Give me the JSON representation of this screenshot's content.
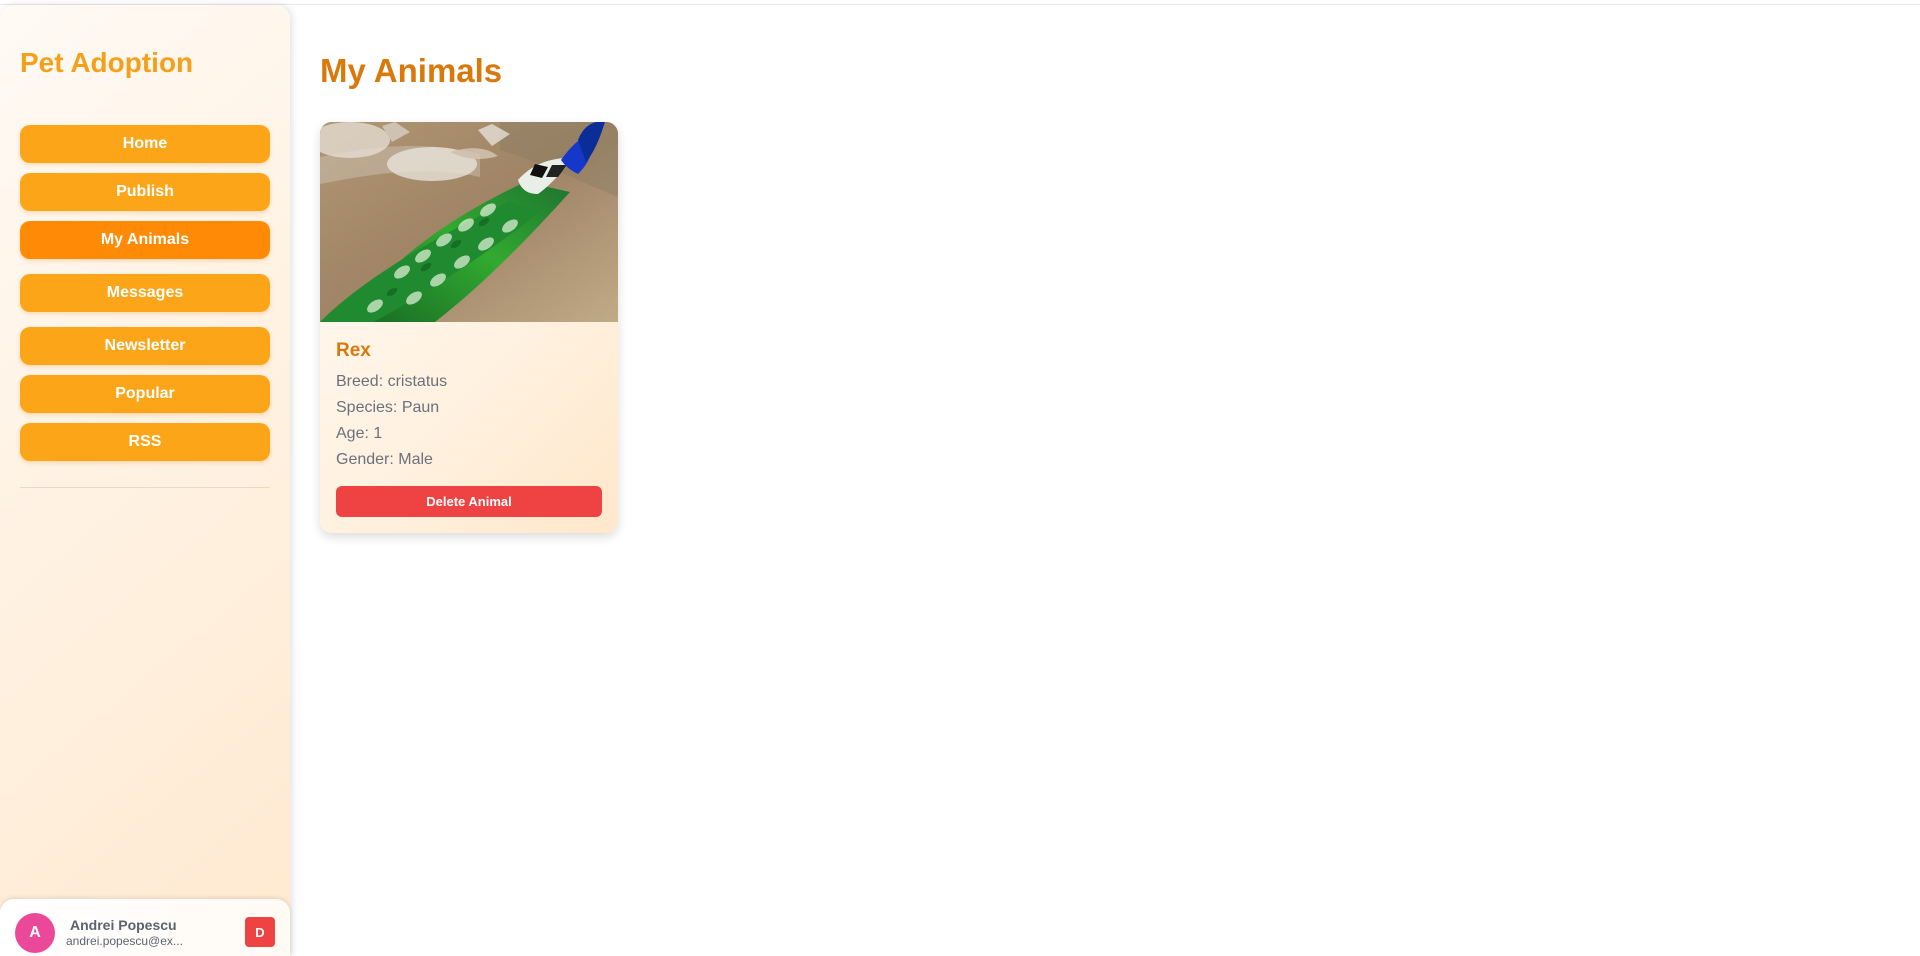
{
  "sidebar": {
    "logo": "Pet Adoption",
    "nav": [
      {
        "label": "Home",
        "active": false
      },
      {
        "label": "Publish",
        "active": false
      },
      {
        "label": "My Animals",
        "active": true
      },
      {
        "label": "Messages",
        "active": false
      },
      {
        "label": "Newsletter",
        "active": false
      },
      {
        "label": "Popular",
        "active": false
      },
      {
        "label": "RSS",
        "active": false
      }
    ]
  },
  "user": {
    "avatar_initial": "A",
    "name": "Andrei Popescu",
    "email": "andrei.popescu@ex...",
    "logout_label": "D"
  },
  "main": {
    "title": "My Animals",
    "animals": [
      {
        "name": "Rex",
        "breed": "Breed: cristatus",
        "species": "Species: Paun",
        "age": "Age: 1",
        "gender": "Gender: Male",
        "delete_label": "Delete Animal",
        "image_subject": "peacock-photo"
      }
    ]
  },
  "colors": {
    "brand": "#f5a01a",
    "nav_button": "#fda519",
    "nav_active": "#ff8a06",
    "title": "#d9790c",
    "danger": "#ef4343",
    "avatar": "#ec4899"
  }
}
